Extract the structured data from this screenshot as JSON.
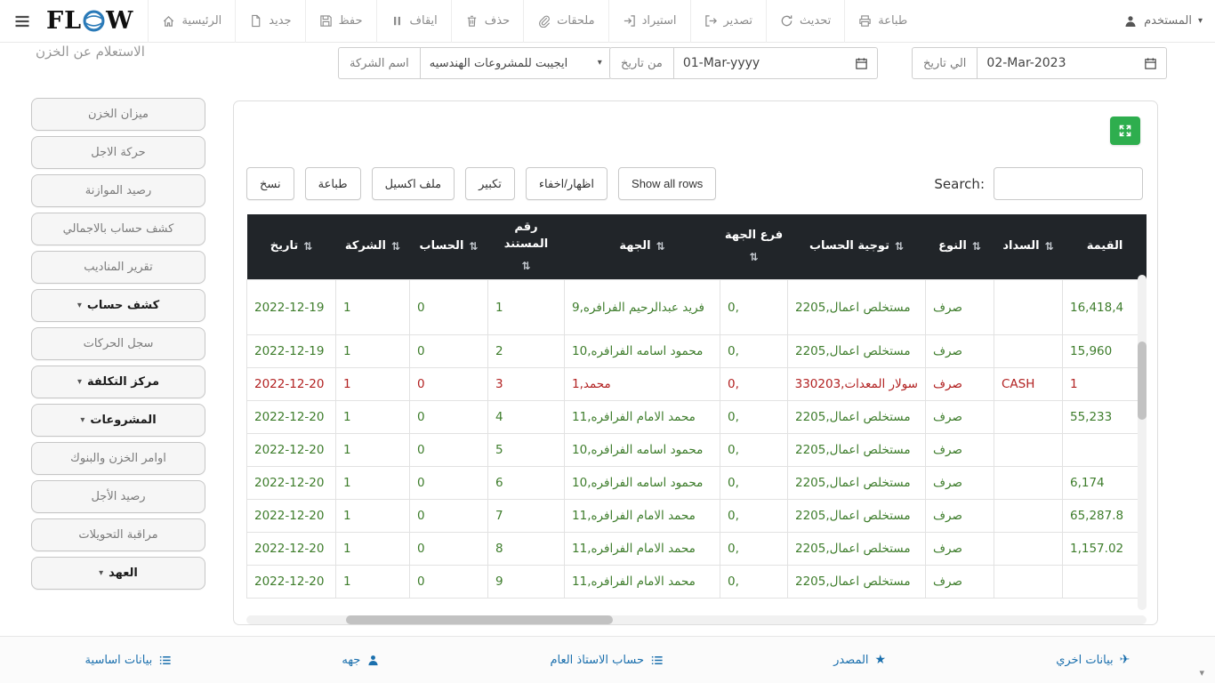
{
  "page": {
    "title": "الاستعلام عن الخزن"
  },
  "navbar": {
    "logo": {
      "prefix": "FL",
      "suffix": "W"
    },
    "items": [
      {
        "label": "الرئيسية"
      },
      {
        "label": "جديد"
      },
      {
        "label": "حفظ"
      },
      {
        "label": "ايقاف"
      },
      {
        "label": "حذف"
      },
      {
        "label": "ملحقات"
      },
      {
        "label": "استيراد"
      },
      {
        "label": "تصدير"
      },
      {
        "label": "تحديث"
      },
      {
        "label": "طباعة"
      }
    ],
    "user_label": "المستخدم"
  },
  "filters": {
    "company_label": "اسم الشركة",
    "company_value": "ايجيبت للمشروعات الهندسيه",
    "from_label": "من تاريخ",
    "from_value": "01-Mar-yyyy",
    "to_label": "الي تاريخ",
    "to_value": "02-Mar-2023"
  },
  "sidebar": {
    "items": [
      {
        "label": "ميزان الخزن"
      },
      {
        "label": "حركة الاجل"
      },
      {
        "label": "رصيد الموازنة"
      },
      {
        "label": "كشف حساب بالاجمالي"
      },
      {
        "label": "تقرير المناديب"
      },
      {
        "label": "كشف حساب"
      },
      {
        "label": "سجل الحركات"
      },
      {
        "label": "مركز التكلفة"
      },
      {
        "label": "المشروعات"
      },
      {
        "label": "اوامر الخزن والبنوك"
      },
      {
        "label": "رصيد الأجل"
      },
      {
        "label": "مراقبة التحويلات"
      },
      {
        "label": "العهد"
      }
    ]
  },
  "toolbar": {
    "copy": "نسخ",
    "print": "طباعة",
    "excel": "ملف اكسيل",
    "enlarge": "تكبير",
    "show_hide": "اظهار/اخفاء",
    "show_all": "Show all rows",
    "search_label": "Search:"
  },
  "table": {
    "columns": [
      "تاريخ",
      "الشركة",
      "الحساب",
      "رقم المستند",
      "الجهة",
      "فرع الجهة",
      "توجية الحساب",
      "النوع",
      "السداد",
      "القيمة"
    ],
    "rows": [
      [
        "2022-12-19",
        "1",
        "0",
        "1",
        "فريد عبدالرحيم الفرافره,9",
        "0,",
        "مستخلص اعمال,2205",
        "صرف",
        "",
        "16,418,4"
      ],
      [
        "2022-12-19",
        "1",
        "0",
        "2",
        "محمود اسامه الفرافره,10",
        "0,",
        "مستخلص اعمال,2205",
        "صرف",
        "",
        "15,960"
      ],
      [
        "2022-12-20",
        "1",
        "0",
        "3",
        "محمد,1",
        "0,",
        "سولار المعدات,330203",
        "صرف",
        "CASH",
        "1"
      ],
      [
        "2022-12-20",
        "1",
        "0",
        "4",
        "محمد الامام الفرافره,11",
        "0,",
        "مستخلص اعمال,2205",
        "صرف",
        "",
        "55,233"
      ],
      [
        "2022-12-20",
        "1",
        "0",
        "5",
        "محمود اسامه الفرافره,10",
        "0,",
        "مستخلص اعمال,2205",
        "صرف",
        "",
        ""
      ],
      [
        "2022-12-20",
        "1",
        "0",
        "6",
        "محمود اسامه الفرافره,10",
        "0,",
        "مستخلص اعمال,2205",
        "صرف",
        "",
        "6,174"
      ],
      [
        "2022-12-20",
        "1",
        "0",
        "7",
        "محمد الامام الفرافره,11",
        "0,",
        "مستخلص اعمال,2205",
        "صرف",
        "",
        "65,287.8"
      ],
      [
        "2022-12-20",
        "1",
        "0",
        "8",
        "محمد الامام الفرافره,11",
        "0,",
        "مستخلص اعمال,2205",
        "صرف",
        "",
        "1,157.02"
      ],
      [
        "2022-12-20",
        "1",
        "0",
        "9",
        "محمد الامام الفرافره,11",
        "0,",
        "مستخلص اعمال,2205",
        "صرف",
        "",
        ""
      ]
    ]
  },
  "footer": {
    "items": [
      {
        "label": "بيانات اساسية",
        "icon": "list-icon"
      },
      {
        "label": "جهه",
        "icon": "user-icon"
      },
      {
        "label": "حساب الاستاذ العام",
        "icon": "list-icon"
      },
      {
        "label": "المصدر",
        "icon": "star-icon"
      },
      {
        "label": "بيانات اخري",
        "icon": "plane-icon"
      }
    ]
  },
  "icons": {
    "caret_down": "▾",
    "sort": "⇅",
    "star": "★",
    "plane": "✈"
  },
  "colors": {
    "accent_green": "#2eae4e",
    "row_green": "#3e7d2c",
    "row_red": "#b22222",
    "header_bg": "#212529",
    "link_blue": "#1a6fad",
    "logo_blue": "#2a7ab8"
  }
}
